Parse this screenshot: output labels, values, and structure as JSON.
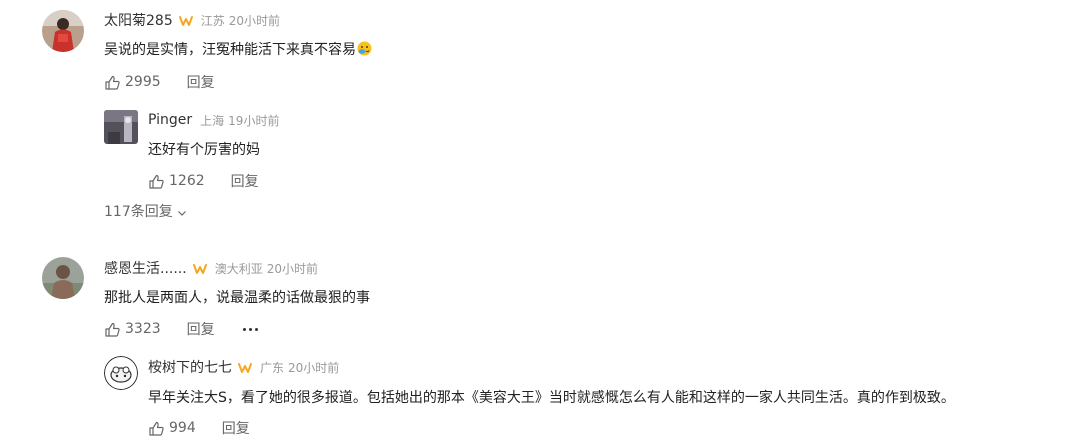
{
  "comments": [
    {
      "username": "太阳菊285",
      "location": "江苏",
      "time": "20小时前",
      "content": "吴说的是实情，汪冤种能活下来真不容易",
      "likes": "2995",
      "reply_label": "回复",
      "replies": [
        {
          "username": "Pinger",
          "location": "上海",
          "time": "19小时前",
          "content": "还好有个厉害的妈",
          "likes": "1262",
          "reply_label": "回复"
        }
      ],
      "more_replies_label": "117条回复"
    },
    {
      "username": "感恩生活......",
      "location": "澳大利亚",
      "time": "20小时前",
      "content": "那批人是两面人，说最温柔的话做最狠的事",
      "likes": "3323",
      "reply_label": "回复",
      "replies": [
        {
          "username": "桉树下的七七",
          "location": "广东",
          "time": "20小时前",
          "content": "早年关注大S，看了她的很多报道。包括她出的那本《美容大王》当时就感慨怎么有人能和这样的一家人共同生活。真的作到极致。",
          "likes": "994",
          "reply_label": "回复"
        }
      ]
    }
  ],
  "colors": {
    "badge": "#f5a623",
    "meta_text": "#999999",
    "action_text": "#666666"
  },
  "icons": {
    "badge": "vip-badge-icon",
    "like": "thumbs-up-icon",
    "expand": "chevron-down-icon",
    "more": "more-dots-icon",
    "emoji": "emoji-icon"
  }
}
